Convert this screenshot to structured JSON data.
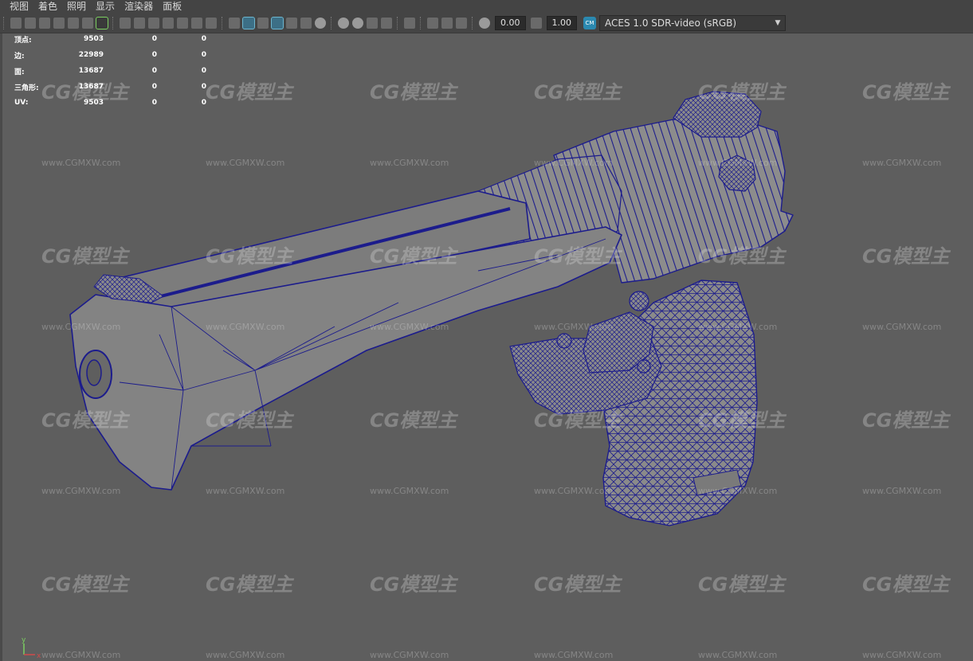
{
  "menu": [
    "视图",
    "着色",
    "照明",
    "显示",
    "渲染器",
    "面板"
  ],
  "toolbar": {
    "exposure_value": "0.00",
    "gamma_value": "1.00",
    "colorspace": "ACES 1.0 SDR-video (sRGB)"
  },
  "hud": {
    "rows": [
      {
        "label": "顶点:",
        "value": "9503",
        "a": "0",
        "b": "0"
      },
      {
        "label": "边:",
        "value": "22989",
        "a": "0",
        "b": "0"
      },
      {
        "label": "面:",
        "value": "13687",
        "a": "0",
        "b": "0"
      },
      {
        "label": "三角形:",
        "value": "13687",
        "a": "0",
        "b": "0"
      },
      {
        "label": "UV:",
        "value": "9503",
        "a": "0",
        "b": "0"
      }
    ]
  },
  "watermark": {
    "logo": "CG模型主",
    "url": "www.CGMXW.com"
  },
  "axis": {
    "x": "x",
    "y": "y"
  },
  "colors": {
    "background": "#5e5e5e",
    "wireframe": "#1c1c8c",
    "mesh_fill": "#808080",
    "toolbar_bg": "#444444",
    "active_icon": "#3c6f86"
  }
}
